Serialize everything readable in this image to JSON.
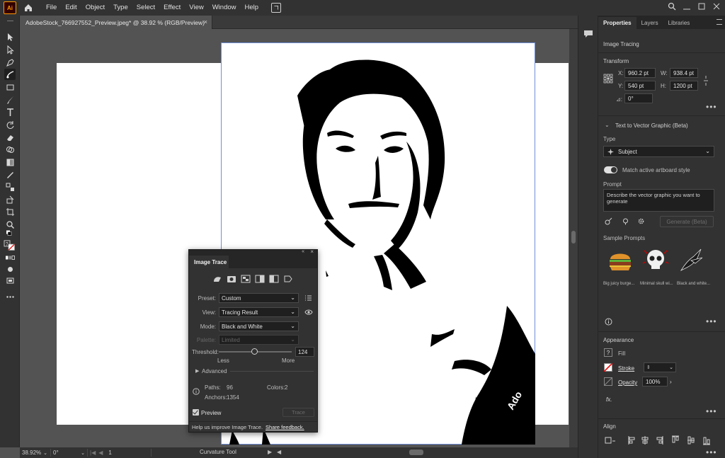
{
  "app": {
    "logo_text": "Ai",
    "menus": [
      "File",
      "Edit",
      "Object",
      "Type",
      "Select",
      "Effect",
      "View",
      "Window",
      "Help"
    ]
  },
  "document": {
    "tab_title": "AdobeStock_766927552_Preview.jpeg* @ 38.92 % (RGB/Preview)",
    "close_glyph": "×"
  },
  "status": {
    "zoom": "38.92%",
    "rotation": "0°",
    "artboard_number": "1",
    "current_tool": "Curvature Tool"
  },
  "properties": {
    "tabs": [
      "Properties",
      "Layers",
      "Libraries"
    ],
    "selection_type": "Image Tracing",
    "transform": {
      "title": "Transform",
      "x_label": "X:",
      "x_value": "960.2 pt",
      "y_label": "Y:",
      "y_value": "540 pt",
      "w_label": "W:",
      "w_value": "938.4 pt",
      "h_label": "H:",
      "h_value": "1200 pt",
      "angle_label": "⊿:",
      "angle_value": "0°"
    },
    "text_to_vector": {
      "title": "Text to Vector Graphic (Beta)",
      "type_label": "Type",
      "type_value": "Subject",
      "match_style_label": "Match active artboard style",
      "prompt_label": "Prompt",
      "prompt_placeholder": "Describe the vector graphic you want to generate",
      "generate_label": "Generate (Beta)",
      "sample_prompts_label": "Sample Prompts",
      "samples": [
        "Big juicy burge...",
        "Minimal skull wi...",
        "Black and white..."
      ]
    },
    "appearance": {
      "title": "Appearance",
      "fill_label": "Fill",
      "stroke_label": "Stroke",
      "opacity_label": "Opacity",
      "opacity_value": "100%",
      "fx_label": "fx."
    },
    "align": {
      "title": "Align"
    }
  },
  "image_trace": {
    "title": "Image Trace",
    "preset_label": "Preset:",
    "preset_value": "Custom",
    "view_label": "View:",
    "view_value": "Tracing Result",
    "mode_label": "Mode:",
    "mode_value": "Black and White",
    "palette_label": "Palette:",
    "palette_value": "Limited",
    "threshold_label": "Threshold:",
    "threshold_value": "124",
    "threshold_fraction": 0.49,
    "less_label": "Less",
    "more_label": "More",
    "advanced_label": "Advanced",
    "paths_label": "Paths:",
    "paths_value": "96",
    "colors_label": "Colors:",
    "colors_value": "2",
    "anchors_label": "Anchors:",
    "anchors_value": "1354",
    "preview_label": "Preview",
    "trace_button": "Trace",
    "footer_text": "Help us improve Image Trace.",
    "feedback_link": "Share feedback."
  }
}
